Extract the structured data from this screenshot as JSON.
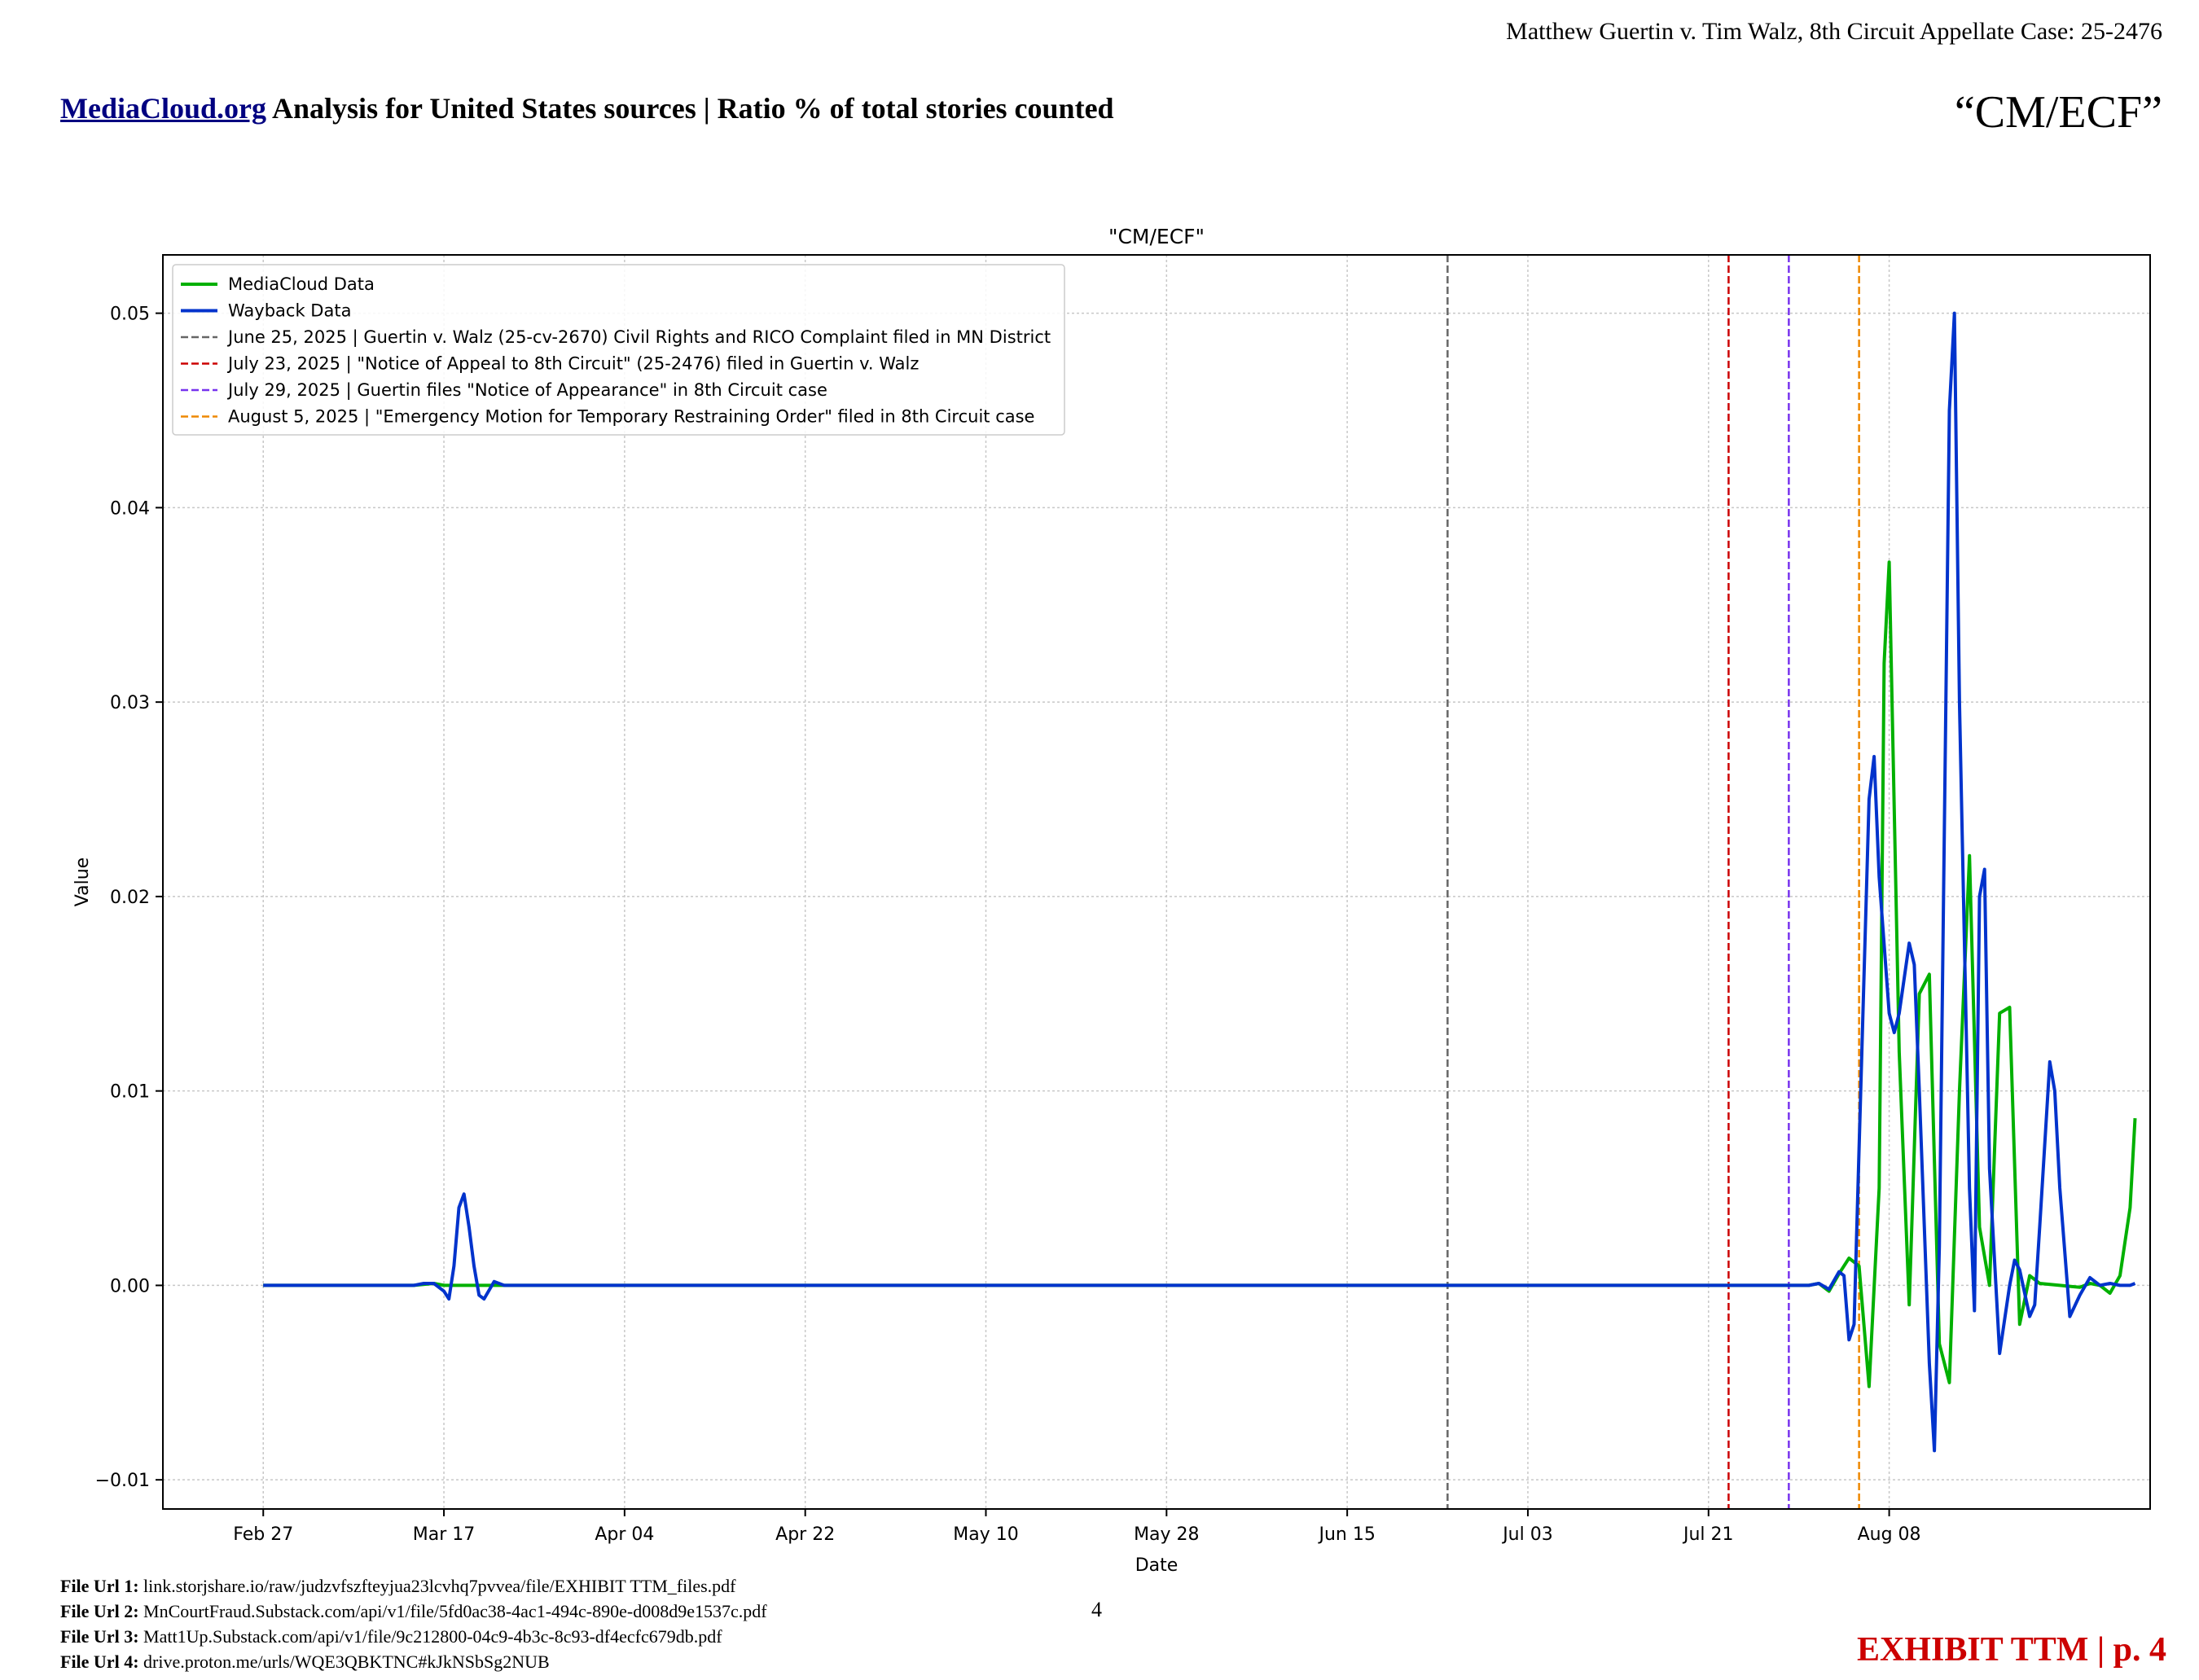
{
  "header": {
    "case": "Matthew Guertin v. Tim Walz, 8th Circuit Appellate Case: 25-2476",
    "heading_link": "MediaCloud.org",
    "heading_rest": " Analysis for United States sources | Ratio % of total stories counted",
    "quote": "“CM/ECF”"
  },
  "chart_data": {
    "type": "line",
    "title": "\"CM/ECF\"",
    "xlabel": "Date",
    "ylabel": "Value",
    "xlim": [
      "2025-02-17",
      "2025-09-03"
    ],
    "ylim": [
      -0.0115,
      0.053
    ],
    "grid": true,
    "legend_position": "top-left",
    "x_ticks": [
      {
        "date": "2025-02-27",
        "label": "Feb 27"
      },
      {
        "date": "2025-03-17",
        "label": "Mar 17"
      },
      {
        "date": "2025-04-04",
        "label": "Apr 04"
      },
      {
        "date": "2025-04-22",
        "label": "Apr 22"
      },
      {
        "date": "2025-05-10",
        "label": "May 10"
      },
      {
        "date": "2025-05-28",
        "label": "May 28"
      },
      {
        "date": "2025-06-15",
        "label": "Jun 15"
      },
      {
        "date": "2025-07-03",
        "label": "Jul 03"
      },
      {
        "date": "2025-07-21",
        "label": "Jul 21"
      },
      {
        "date": "2025-08-08",
        "label": "Aug 08"
      }
    ],
    "y_ticks": [
      {
        "value": -0.01,
        "label": "−0.01"
      },
      {
        "value": 0.0,
        "label": "0.00"
      },
      {
        "value": 0.01,
        "label": "0.01"
      },
      {
        "value": 0.02,
        "label": "0.02"
      },
      {
        "value": 0.03,
        "label": "0.03"
      },
      {
        "value": 0.04,
        "label": "0.04"
      },
      {
        "value": 0.05,
        "label": "0.05"
      }
    ],
    "series": [
      {
        "name": "MediaCloud Data",
        "color": "#00b000",
        "points": [
          [
            "2025-02-27",
            0
          ],
          [
            "2025-03-14",
            0
          ],
          [
            "2025-03-16",
            0.0001
          ],
          [
            "2025-03-17",
            0
          ],
          [
            "2025-03-19",
            0
          ],
          [
            "2025-07-31",
            0
          ],
          [
            "2025-08-01",
            0.0001
          ],
          [
            "2025-08-02",
            -0.0003
          ],
          [
            "2025-08-03",
            0.0006
          ],
          [
            "2025-08-04",
            0.0014
          ],
          [
            "2025-08-05",
            0.001
          ],
          [
            "2025-08-06",
            -0.0052
          ],
          [
            "2025-08-07",
            0.005
          ],
          [
            "2025-08-07T12:00",
            0.032
          ],
          [
            "2025-08-08",
            0.0372
          ],
          [
            "2025-08-09",
            0.012
          ],
          [
            "2025-08-10",
            -0.001
          ],
          [
            "2025-08-11",
            0.015
          ],
          [
            "2025-08-12",
            0.016
          ],
          [
            "2025-08-13",
            -0.003
          ],
          [
            "2025-08-14",
            -0.005
          ],
          [
            "2025-08-15",
            0.01
          ],
          [
            "2025-08-16",
            0.0221
          ],
          [
            "2025-08-17",
            0.003
          ],
          [
            "2025-08-18",
            0.0
          ],
          [
            "2025-08-19",
            0.014
          ],
          [
            "2025-08-20",
            0.0143
          ],
          [
            "2025-08-21",
            -0.002
          ],
          [
            "2025-08-22",
            0.0005
          ],
          [
            "2025-08-23",
            0.0001
          ],
          [
            "2025-08-25",
            0.0
          ],
          [
            "2025-08-27",
            -0.0001
          ],
          [
            "2025-08-28",
            0.0001
          ],
          [
            "2025-08-29",
            0.0
          ],
          [
            "2025-08-30",
            -0.0004
          ],
          [
            "2025-08-31",
            0.0005
          ],
          [
            "2025-09-01",
            0.004
          ],
          [
            "2025-09-01T12:00",
            0.0086
          ]
        ]
      },
      {
        "name": "Wayback Data",
        "color": "#0033cc",
        "points": [
          [
            "2025-02-27",
            0
          ],
          [
            "2025-03-14",
            0
          ],
          [
            "2025-03-15",
            0.0001
          ],
          [
            "2025-03-16",
            0.0001
          ],
          [
            "2025-03-17",
            -0.0003
          ],
          [
            "2025-03-17T12:00",
            -0.0007
          ],
          [
            "2025-03-18",
            0.001
          ],
          [
            "2025-03-18T12:00",
            0.004
          ],
          [
            "2025-03-19",
            0.0047
          ],
          [
            "2025-03-19T12:00",
            0.003
          ],
          [
            "2025-03-20",
            0.001
          ],
          [
            "2025-03-20T12:00",
            -0.0005
          ],
          [
            "2025-03-21",
            -0.0007
          ],
          [
            "2025-03-22",
            0.0002
          ],
          [
            "2025-03-23",
            0.0
          ],
          [
            "2025-07-31",
            0
          ],
          [
            "2025-08-01",
            0.0001
          ],
          [
            "2025-08-02",
            -0.0002
          ],
          [
            "2025-08-03",
            0.0007
          ],
          [
            "2025-08-03T12:00",
            0.0005
          ],
          [
            "2025-08-04",
            -0.0028
          ],
          [
            "2025-08-04T12:00",
            -0.002
          ],
          [
            "2025-08-05",
            0.007
          ],
          [
            "2025-08-06",
            0.025
          ],
          [
            "2025-08-06T12:00",
            0.0272
          ],
          [
            "2025-08-07",
            0.021
          ],
          [
            "2025-08-08",
            0.014
          ],
          [
            "2025-08-08T12:00",
            0.013
          ],
          [
            "2025-08-09",
            0.014
          ],
          [
            "2025-08-10",
            0.0176
          ],
          [
            "2025-08-10T12:00",
            0.0165
          ],
          [
            "2025-08-11",
            0.01
          ],
          [
            "2025-08-12",
            -0.004
          ],
          [
            "2025-08-12T12:00",
            -0.0085
          ],
          [
            "2025-08-13",
            0.002
          ],
          [
            "2025-08-14",
            0.045
          ],
          [
            "2025-08-14T12:00",
            0.05
          ],
          [
            "2025-08-15",
            0.03
          ],
          [
            "2025-08-16",
            0.005
          ],
          [
            "2025-08-16T12:00",
            -0.0013
          ],
          [
            "2025-08-17",
            0.02
          ],
          [
            "2025-08-17T12:00",
            0.0214
          ],
          [
            "2025-08-18",
            0.006
          ],
          [
            "2025-08-19",
            -0.0035
          ],
          [
            "2025-08-20",
            0.0
          ],
          [
            "2025-08-20T12:00",
            0.0013
          ],
          [
            "2025-08-21",
            0.0008
          ],
          [
            "2025-08-22",
            -0.0016
          ],
          [
            "2025-08-22T12:00",
            -0.001
          ],
          [
            "2025-08-23",
            0.003
          ],
          [
            "2025-08-24",
            0.0115
          ],
          [
            "2025-08-24T12:00",
            0.01
          ],
          [
            "2025-08-25",
            0.005
          ],
          [
            "2025-08-26",
            -0.0016
          ],
          [
            "2025-08-27",
            -0.0005
          ],
          [
            "2025-08-28",
            0.0004
          ],
          [
            "2025-08-29",
            0.0
          ],
          [
            "2025-08-30",
            0.0001
          ],
          [
            "2025-08-31",
            0.0
          ],
          [
            "2025-09-01",
            0.0
          ],
          [
            "2025-09-01T12:00",
            0.0001
          ]
        ]
      }
    ],
    "events": [
      {
        "date": "2025-06-25",
        "color": "#666666",
        "label": "June 25, 2025 | Guertin v. Walz (25-cv-2670) Civil Rights and RICO Complaint filed in MN District"
      },
      {
        "date": "2025-07-23",
        "color": "#cc0000",
        "label": "July 23, 2025 | \"Notice of Appeal to 8th Circuit\" (25-2476) filed in Guertin v. Walz"
      },
      {
        "date": "2025-07-29",
        "color": "#7733ee",
        "label": "July 29, 2025 | Guertin files \"Notice of Appearance\" in 8th Circuit case"
      },
      {
        "date": "2025-08-05",
        "color": "#ee8800",
        "label": "August 5, 2025 | \"Emergency Motion for Temporary Restraining Order\" filed in 8th Circuit case"
      }
    ]
  },
  "footer": {
    "url1_label": "File Url 1:",
    "url1": "link.storjshare.io/raw/judzvfszfteyjua23lcvhq7pvvea/file/EXHIBIT TTM_files.pdf",
    "url2_label": "File Url 2:",
    "url2": "MnCourtFraud.Substack.com/api/v1/file/5fd0ac38-4ac1-494c-890e-d008d9e1537c.pdf",
    "url3_label": "File Url 3:",
    "url3": "Matt1Up.Substack.com/api/v1/file/9c212800-04c9-4b3c-8c93-df4ecfc679db.pdf",
    "url4_label": "File Url 4:",
    "url4": "drive.proton.me/urls/WQE3QBKTNC#kJkNSbSg2NUB",
    "page_number": "4",
    "exhibit": "EXHIBIT TTM | p. 4"
  }
}
